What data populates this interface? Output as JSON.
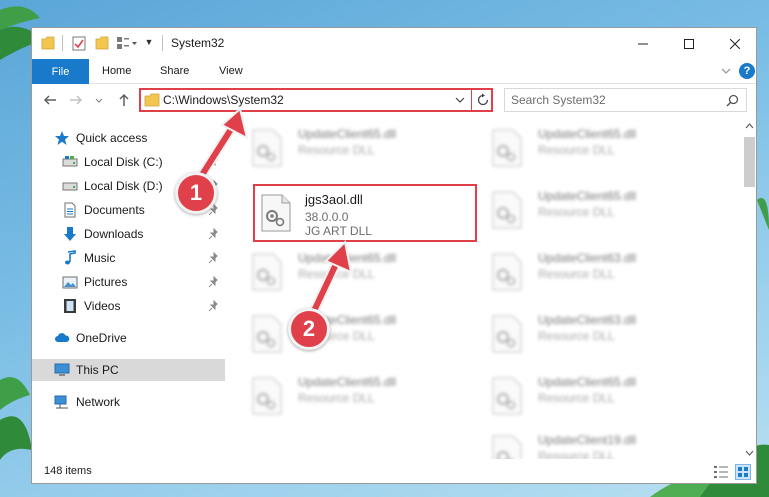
{
  "window": {
    "title": "System32",
    "controls": {
      "minimize": "minimize",
      "maximize": "maximize",
      "close": "close"
    }
  },
  "ribbon": {
    "file_tab": "File",
    "tabs": [
      "Home",
      "Share",
      "View"
    ],
    "help_label": "?"
  },
  "navigation": {
    "address": "C:\\Windows\\System32",
    "search_placeholder": "Search System32"
  },
  "sidebar": {
    "items": [
      {
        "label": "Quick access",
        "icon": "star-icon",
        "pinned": false
      },
      {
        "label": "Local Disk (C:)",
        "icon": "drive-icon",
        "pinned": true
      },
      {
        "label": "Local Disk (D:)",
        "icon": "drive-icon",
        "pinned": true
      },
      {
        "label": "Documents",
        "icon": "documents-icon",
        "pinned": true
      },
      {
        "label": "Downloads",
        "icon": "download-icon",
        "pinned": true
      },
      {
        "label": "Music",
        "icon": "music-icon",
        "pinned": true
      },
      {
        "label": "Pictures",
        "icon": "pictures-icon",
        "pinned": true
      },
      {
        "label": "Videos",
        "icon": "videos-icon",
        "pinned": true
      },
      {
        "label": "OneDrive",
        "icon": "cloud-icon",
        "pinned": false
      },
      {
        "label": "This PC",
        "icon": "computer-icon",
        "pinned": false,
        "selected": true
      },
      {
        "label": "Network",
        "icon": "network-icon",
        "pinned": false
      }
    ]
  },
  "files": {
    "highlighted": {
      "name": "jgs3aol.dll",
      "version": "38.0.0.0",
      "description": "JG ART DLL"
    },
    "left_column": [
      {
        "name": "UpdateClient65.dll",
        "type": "Resource DLL"
      },
      {
        "name": "UpdateClient65.dll",
        "type": "Resource DLL"
      },
      {
        "name": "UpdateClient65.dll",
        "type": "Resource DLL"
      },
      {
        "name": "UpdateClient65.dll",
        "type": "Resource DLL"
      }
    ],
    "right_column": [
      {
        "name": "UpdateClient65.dll",
        "type": "Resource DLL"
      },
      {
        "name": "UpdateClient65.dll",
        "type": "Resource DLL"
      },
      {
        "name": "UpdateClient63.dll",
        "type": "Resource DLL"
      },
      {
        "name": "UpdateClient63.dll",
        "type": "Resource DLL"
      },
      {
        "name": "UpdateClient65.dll",
        "type": "Resource DLL"
      },
      {
        "name": "UpdateClient19.dll",
        "type": "Resource DLL"
      }
    ]
  },
  "status": {
    "item_count": "148 items"
  },
  "annotations": {
    "step_1": "1",
    "step_2": "2"
  },
  "colors": {
    "accent": "#1979ca",
    "highlight": "#e0404a",
    "selection": "#d9d9d9"
  }
}
